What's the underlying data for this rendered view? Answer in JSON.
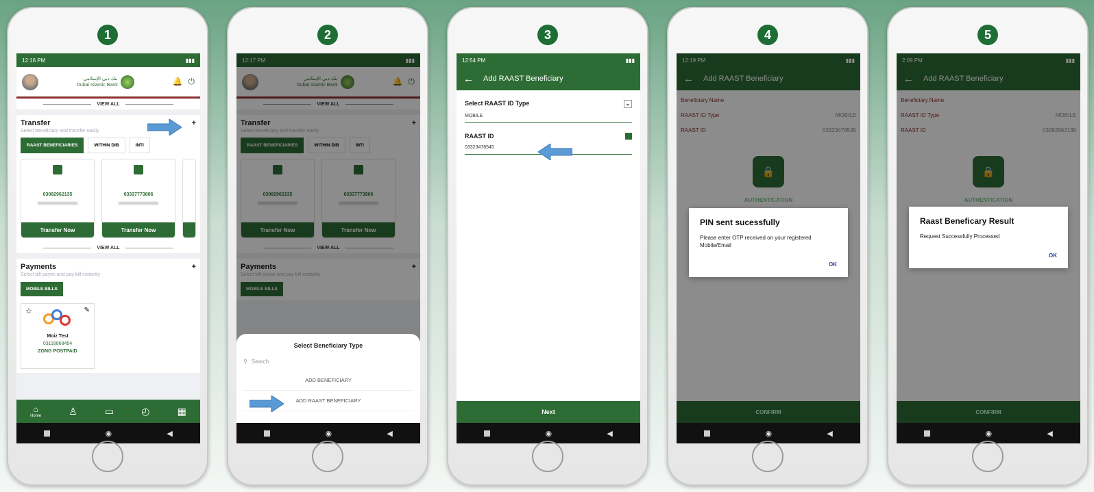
{
  "steps": [
    "1",
    "2",
    "3",
    "4",
    "5"
  ],
  "screen1": {
    "status_time": "12:16 PM",
    "bank_name_ar": "بنك دبي الإسلامي",
    "bank_name": "Dubai Islamic Bank",
    "view_all": "VIEW ALL",
    "transfer_title": "Transfer",
    "transfer_sub": "Select beneficiary and transfer easily",
    "tabs": [
      "RAAST BENEFICIARIES",
      "WITHIN DIB",
      "INTI"
    ],
    "cards": [
      {
        "number": "03082962135",
        "button": "Transfer Now"
      },
      {
        "number": "03337773806",
        "button": "Transfer Now"
      }
    ],
    "payments_title": "Payments",
    "payments_sub": "Select bill payee and pay bill instantly",
    "mobile_bills": "MOBILE BILLS",
    "bill": {
      "name": "Moiz Test",
      "number": "03118868454",
      "provider": "ZONG POSTPAID"
    },
    "nav_home": "Home"
  },
  "screen2": {
    "status_time": "12:17 PM",
    "sheet_title": "Select Beneficiary Type",
    "search_placeholder": "Search",
    "options": [
      "ADD BENEFICIARY",
      "ADD RAAST BENEFICIARY"
    ]
  },
  "screen3": {
    "status_time": "12:54 PM",
    "title": "Add RAAST Beneficiary",
    "id_type_label": "Select RAAST ID Type",
    "id_type_value": "MOBILE",
    "id_label": "RAAST ID",
    "id_value": "03323478545",
    "next": "Next"
  },
  "screen4": {
    "status_time": "12:19 PM",
    "title": "Add RAAST Beneficiary",
    "rows": [
      {
        "k": "Beneficiary Name",
        "v": ""
      },
      {
        "k": "RAAST ID Type",
        "v": "MOBILE"
      },
      {
        "k": "RAAST ID",
        "v": "03323478545"
      }
    ],
    "auth": "AUTHENTICATION",
    "dialog_title": "PIN sent sucessfully",
    "dialog_msg": "Please enter OTP received on your registered Mobile/Email",
    "ok": "OK",
    "confirm": "CONFIRM"
  },
  "screen5": {
    "status_time": "2:09 PM",
    "title": "Add RAAST Beneficiary",
    "rows": [
      {
        "k": "Beneficiary Name",
        "v": ""
      },
      {
        "k": "RAAST ID Type",
        "v": "MOBILE"
      },
      {
        "k": "RAAST ID",
        "v": "03082962135"
      }
    ],
    "auth": "AUTHENTICATION",
    "dialog_title": "Raast Beneficary Result",
    "dialog_msg": "Request Successfully Processed",
    "ok": "OK",
    "confirm": "CONFIRM"
  },
  "colors": {
    "brand_green": "#2e6c35",
    "arrow_blue": "#5b9bd5",
    "ok_blue": "#2a3f8c"
  }
}
